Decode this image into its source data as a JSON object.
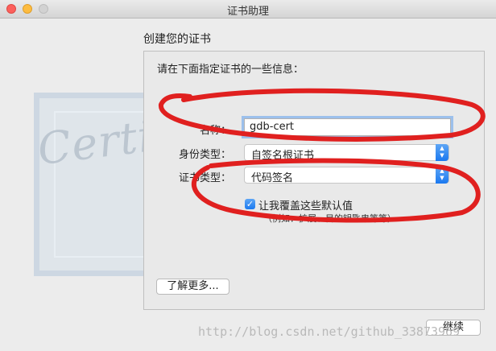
{
  "window": {
    "title": "证书助理"
  },
  "page": {
    "heading": "创建您的证书",
    "prompt": "请在下面指定证书的一些信息："
  },
  "form": {
    "name_label": "名称：",
    "name_value": "gdb-cert",
    "identity_label": "身份类型：",
    "identity_value": "自签名根证书",
    "cert_type_label": "证书类型：",
    "cert_type_value": "代码签名",
    "override_label": "让我覆盖这些默认值",
    "override_hint": "（例如：扩展、目的钥匙串等等）",
    "override_checked": true
  },
  "certificate_art": {
    "word": "Certificate"
  },
  "buttons": {
    "learn_more": "了解更多...",
    "continue": "继续"
  },
  "watermark": "http://blog.csdn.net/github_33873969",
  "annotation_color": "#e0201f"
}
